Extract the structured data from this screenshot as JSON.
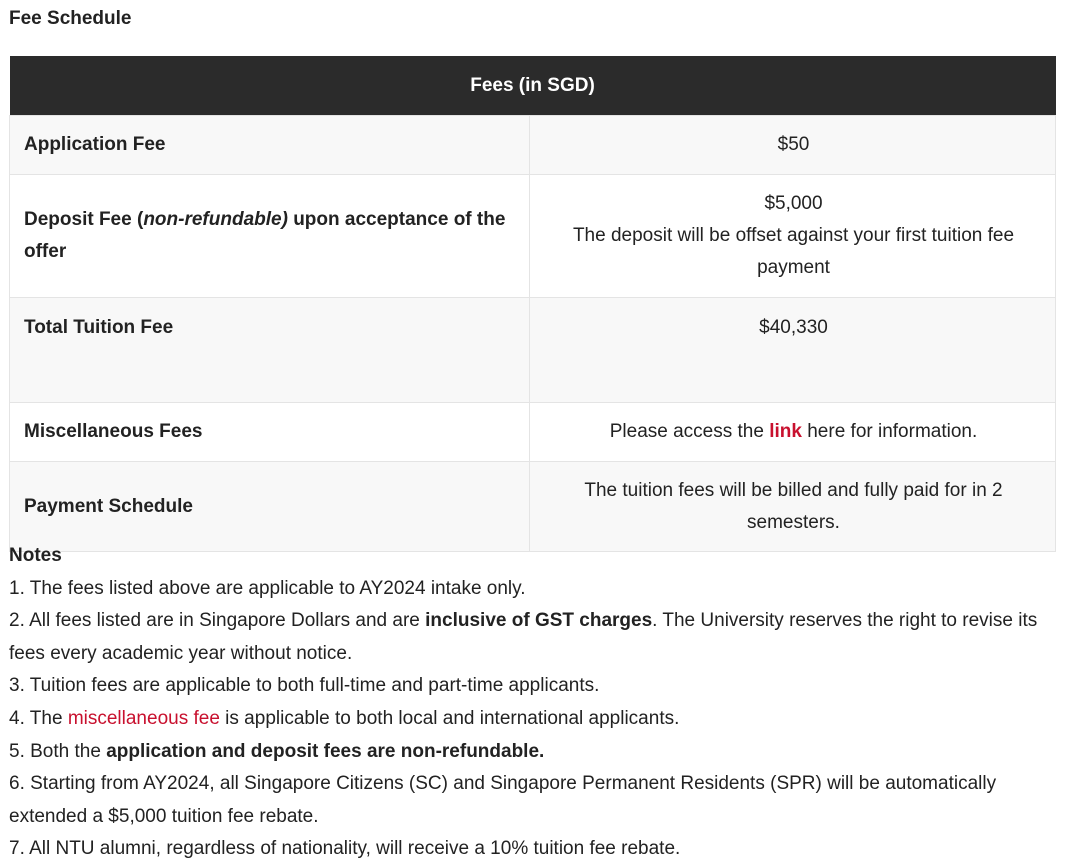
{
  "heading": "Fee Schedule",
  "table": {
    "header_label": "",
    "header_fees": "Fees (in SGD)",
    "rows": [
      {
        "label": "Application Fee",
        "value": "$50"
      },
      {
        "label_pre": "Deposit Fee (",
        "label_italic": "non-refundable)",
        "label_post": " upon acceptance of the offer",
        "value": "$5,000",
        "value_note": "The deposit will be offset against your first tuition fee payment"
      },
      {
        "label": "Total Tuition Fee",
        "value": "$40,330"
      },
      {
        "label": "Miscellaneous Fees",
        "value_pre": "Please access the ",
        "value_link": "link",
        "value_post": " here for information."
      },
      {
        "label": "Payment Schedule",
        "value": "The tuition fees will be billed and fully paid for in 2 semesters."
      }
    ]
  },
  "notes": {
    "title": "Notes",
    "n1": "1. The fees listed above are applicable to AY2024 intake only.",
    "n2_pre": "2. All fees listed are in Singapore Dollars and are ",
    "n2_bold": "inclusive of GST charges",
    "n2_post": ". The University reserves the right to revise its fees every academic year without notice.",
    "n3": "3. Tuition fees are applicable to both full-time and part-time applicants.",
    "n4_pre": "4. The ",
    "n4_link": "miscellaneous fee",
    "n4_post": " is applicable to both local and international applicants.",
    "n5_pre": "5. Both the ",
    "n5_bold": "application and deposit fees are non-refundable.",
    "n6": "6. Starting from AY2024, all Singapore Citizens (SC) and Singapore Permanent Residents (SPR) will be automatically extended a $5,000 tuition fee rebate.",
    "n7": "7. All NTU alumni, regardless of nationality, will receive a 10% tuition fee rebate."
  },
  "colors": {
    "header_bg": "#2b2b2b",
    "link": "#c8102e",
    "row_shade": "#f8f8f8"
  }
}
